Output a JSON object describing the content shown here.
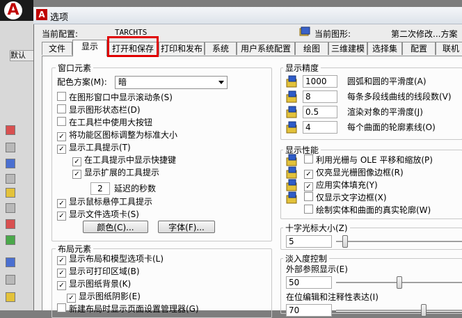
{
  "host": {
    "logo": "A",
    "tab_label": "默认",
    "colors": {
      "dark_bar": "#1a1a1a",
      "logo_red": "#c00000"
    }
  },
  "dialog": {
    "title": "选项",
    "current_profile_label": "当前配置:",
    "current_profile_value": "TARCHTS",
    "current_drawing_label": "当前图形:",
    "current_drawing_value": "第二次修改...方案"
  },
  "tabs": [
    {
      "label": "文件",
      "active": false
    },
    {
      "label": "显示",
      "active": true
    },
    {
      "label": "打开和保存",
      "active": false,
      "highlighted": true
    },
    {
      "label": "打印和发布",
      "active": false
    },
    {
      "label": "系统",
      "active": false
    },
    {
      "label": "用户系统配置",
      "active": false
    },
    {
      "label": "绘图",
      "active": false
    },
    {
      "label": "三维建模",
      "active": false
    },
    {
      "label": "选择集",
      "active": false
    },
    {
      "label": "配置",
      "active": false
    },
    {
      "label": "联机",
      "active": false
    }
  ],
  "window_elements": {
    "title": "窗口元素",
    "color_scheme_label": "配色方案(M):",
    "color_scheme_value": "暗",
    "options": [
      {
        "label": "在图形窗口中显示滚动条(S)",
        "checked": false
      },
      {
        "label": "显示图形状态栏(D)",
        "checked": false
      },
      {
        "label": "在工具栏中使用大按钮",
        "checked": false
      },
      {
        "label": "将功能区图标调整为标准大小",
        "checked": true
      },
      {
        "label": "显示工具提示(T)",
        "checked": true
      }
    ],
    "sub_options": [
      {
        "label": "在工具提示中显示快捷键",
        "checked": true
      },
      {
        "label": "显示扩展的工具提示",
        "checked": true
      }
    ],
    "delay_value": "2",
    "delay_label": "延迟的秒数",
    "more_options": [
      {
        "label": "显示鼠标悬停工具提示",
        "checked": true
      },
      {
        "label": "显示文件选项卡(S)",
        "checked": true
      }
    ],
    "colors_button": "颜色(C)...",
    "fonts_button": "字体(F)..."
  },
  "layout_elements": {
    "title": "布局元素",
    "options": [
      {
        "label": "显示布局和模型选项卡(L)",
        "checked": true
      },
      {
        "label": "显示可打印区域(B)",
        "checked": true
      },
      {
        "label": "显示图纸背景(K)",
        "checked": true
      }
    ],
    "sub_option": {
      "label": "显示图纸阴影(E)",
      "checked": true
    },
    "cut_option": {
      "label": "新建布局时显示页面设置管理器(G)",
      "checked": false
    }
  },
  "display_resolution": {
    "title": "显示精度",
    "items": [
      {
        "value": "1000",
        "label": "圆弧和圆的平滑度(A)"
      },
      {
        "value": "8",
        "label": "每条多段线曲线的线段数(V)"
      },
      {
        "value": "0.5",
        "label": "渲染对象的平滑度(J)"
      },
      {
        "value": "4",
        "label": "每个曲面的轮廓素线(O)"
      }
    ]
  },
  "display_performance": {
    "title": "显示性能",
    "items": [
      {
        "label": "利用光栅与 OLE 平移和缩放(P)",
        "checked": false
      },
      {
        "label": "仅亮显光栅图像边框(R)",
        "checked": true
      },
      {
        "label": "应用实体填充(Y)",
        "checked": true
      },
      {
        "label": "仅显示文字边框(X)",
        "checked": false
      },
      {
        "label": "绘制实体和曲面的真实轮廓(W)",
        "checked": false
      }
    ]
  },
  "crosshair": {
    "title": "十字光标大小(Z)",
    "value": "5",
    "slider_percent": 5
  },
  "fade_control": {
    "title": "淡入度控制",
    "xref_label": "外部参照显示(E)",
    "xref_value": "50",
    "xref_percent": 50,
    "inplace_label": "在位编辑和注释性表达(I)",
    "inplace_value": "70",
    "inplace_percent": 70
  },
  "check_mark": "✓"
}
